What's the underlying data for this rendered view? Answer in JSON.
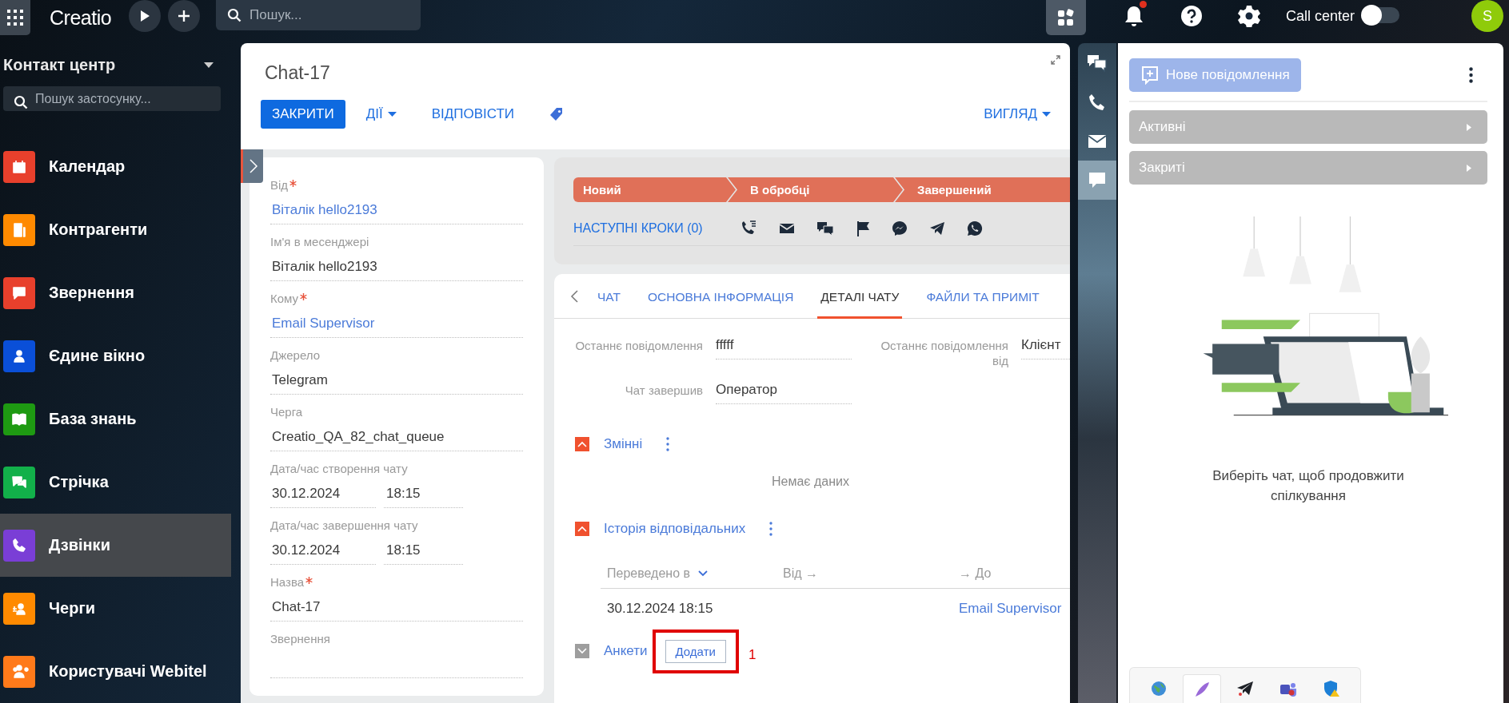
{
  "topbar": {
    "logo": "Creatio",
    "search": {
      "placeholder": "Пошук..."
    },
    "unread": true,
    "call_center": {
      "label": "Call center",
      "on": false
    },
    "avatar": "S"
  },
  "sidebar": {
    "workplace": "Контакт центр",
    "search": {
      "placeholder": "Пошук застосунку..."
    },
    "items": [
      {
        "label": "Календар",
        "color": "#e8402c",
        "selected": false
      },
      {
        "label": "Контрагенти",
        "color": "#ff8a00",
        "selected": false
      },
      {
        "label": "Звернення",
        "color": "#e8402c",
        "selected": false
      },
      {
        "label": "Єдине вікно",
        "color": "#0a4fd8",
        "selected": false
      },
      {
        "label": "База знань",
        "color": "#1e9a12",
        "selected": false
      },
      {
        "label": "Стрічка",
        "color": "#12b04a",
        "selected": false
      },
      {
        "label": "Дзвінки",
        "color": "#7a3ed6",
        "selected": true
      },
      {
        "label": "Черги",
        "color": "#ff8a00",
        "selected": false
      },
      {
        "label": "Користувачі Webitel",
        "color": "#ff7a1a",
        "selected": false
      }
    ]
  },
  "record": {
    "title": "Chat-17",
    "actions": [
      {
        "label": "ЗАКРИТИ",
        "kind": "primary"
      },
      {
        "label": "ДІЇ",
        "kind": "menu"
      },
      {
        "label": "ВІДПОВІСТИ",
        "kind": "link"
      }
    ],
    "view": "ВИГЛЯД",
    "fields": [
      {
        "label": "Від",
        "kind": "text",
        "value": "Віталік hello2193",
        "required": true,
        "link": true
      },
      {
        "label": "Ім'я в месенджері",
        "kind": "text",
        "value": "Віталік hello2193",
        "required": false,
        "link": false
      },
      {
        "label": "Кому",
        "kind": "text",
        "value": "Email Supervisor",
        "required": true,
        "link": true
      },
      {
        "label": "Джерело",
        "kind": "text",
        "value": "Telegram",
        "required": false,
        "link": false
      },
      {
        "label": "Черга",
        "kind": "text",
        "value": "Creatio_QA_82_chat_queue",
        "required": false,
        "link": false
      },
      {
        "label": "Дата/час створення чату",
        "kind": "datetime",
        "date": "30.12.2024",
        "time": "18:15",
        "required": false
      },
      {
        "label": "Дата/час завершення чату",
        "kind": "datetime",
        "date": "30.12.2024",
        "time": "18:15",
        "required": false
      },
      {
        "label": "Назва",
        "kind": "text",
        "value": "Chat-17",
        "required": true,
        "link": false
      },
      {
        "label": "Звернення",
        "kind": "text",
        "required": false
      }
    ],
    "stages": [
      {
        "label": "Новий"
      },
      {
        "label": "В обробці"
      },
      {
        "label": "Завершений"
      }
    ],
    "next_steps": "НАСТУПНІ КРОКИ (0)",
    "tabs": [
      {
        "label": "ЧАТ",
        "selected": false
      },
      {
        "label": "ОСНОВНА ІНФОРМАЦІЯ",
        "selected": false
      },
      {
        "label": "ДЕТАЛІ ЧАТУ",
        "selected": true
      },
      {
        "label": "ФАЙЛИ ТА ПРИМІТ",
        "selected": false
      }
    ],
    "details": [
      {
        "label": "Останнє повідомлення",
        "value": "fffff"
      },
      {
        "label": "Останнє повідомлення від",
        "value": "Клієнт"
      },
      {
        "label": "Чат завершив",
        "value": "Оператор"
      }
    ],
    "groups": [
      {
        "title": "Змінні",
        "kind": "empty",
        "expanded": true,
        "empty_text": "Немає даних"
      },
      {
        "title": "Історія відповідальних",
        "kind": "table",
        "expanded": true,
        "columns": [
          "Переведено в",
          "Від →",
          "→ До"
        ],
        "rows": [
          {
            "transferred": "30.12.2024 18:15",
            "to": "Email Supervisor"
          }
        ]
      },
      {
        "title": "Анкети",
        "kind": "addable",
        "expanded": false,
        "add_button": "Додати",
        "annotation": "1"
      }
    ]
  },
  "side_channels": [
    {
      "selected": false
    },
    {
      "selected": false
    },
    {
      "selected": false
    },
    {
      "selected": true
    }
  ],
  "chat_panel": {
    "new_message": "Нове повідомлення",
    "sections": [
      {
        "label": "Активні"
      },
      {
        "label": "Закриті"
      }
    ],
    "empty_text": "Виберіть чат, щоб продовжити спілкування"
  }
}
